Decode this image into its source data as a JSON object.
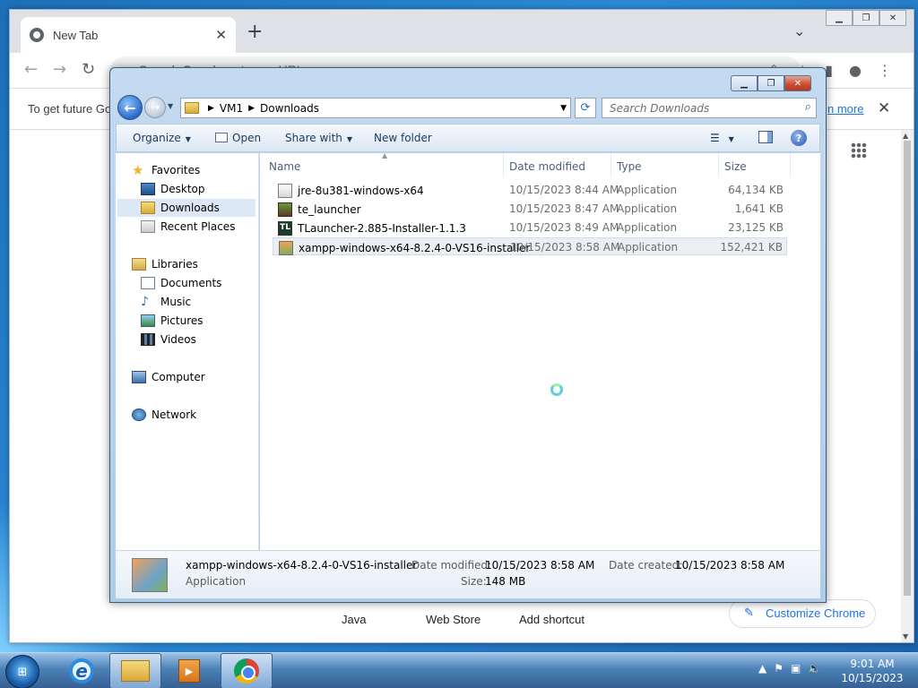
{
  "chrome": {
    "tab_title": "New Tab",
    "tab_close": "✕",
    "new_tab": "+",
    "tab_dropdown": "⌄",
    "omnibox_placeholder": "Search Google or type a URL",
    "infobar_message": "To get future Go",
    "infobar_link": "n more",
    "infobar_close": "✕",
    "shortcuts": [
      "Java",
      "Web Store",
      "Add shortcut"
    ],
    "customize_label": "Customize Chrome"
  },
  "explorer": {
    "breadcrumb": [
      "VM1",
      "Downloads"
    ],
    "search_placeholder": "Search Downloads",
    "commands": {
      "organize": "Organize",
      "open": "Open",
      "share_with": "Share with",
      "new_folder": "New folder"
    },
    "nav": {
      "favorites_header": "Favorites",
      "favorites": [
        "Desktop",
        "Downloads",
        "Recent Places"
      ],
      "libraries_header": "Libraries",
      "libraries": [
        "Documents",
        "Music",
        "Pictures",
        "Videos"
      ],
      "computer": "Computer",
      "network": "Network",
      "selected": "Downloads"
    },
    "columns": [
      "Name",
      "Date modified",
      "Type",
      "Size"
    ],
    "files": [
      {
        "name": "jre-8u381-windows-x64",
        "date": "10/15/2023 8:44 AM",
        "type": "Application",
        "size": "64,134 KB",
        "icon": "java-icon"
      },
      {
        "name": "te_launcher",
        "date": "10/15/2023 8:47 AM",
        "type": "Application",
        "size": "1,641 KB",
        "icon": "minecraft-icon"
      },
      {
        "name": "TLauncher-2.885-Installer-1.1.3",
        "date": "10/15/2023 8:49 AM",
        "type": "Application",
        "size": "23,125 KB",
        "icon": "tlauncher-icon"
      },
      {
        "name": "xampp-windows-x64-8.2.4-0-VS16-installer",
        "date": "10/15/2023 8:58 AM",
        "type": "Application",
        "size": "152,421 KB",
        "icon": "xampp-icon"
      }
    ],
    "selected_file_index": 3,
    "details": {
      "name": "xampp-windows-x64-8.2.4-0-VS16-installer",
      "type": "Application",
      "date_modified_label": "Date modified:",
      "date_modified": "10/15/2023 8:58 AM",
      "date_created_label": "Date created:",
      "date_created": "10/15/2023 8:58 AM",
      "size_label": "Size:",
      "size": "148 MB"
    }
  },
  "taskbar": {
    "time": "9:01 AM",
    "date": "10/15/2023"
  },
  "colors": {
    "accent": "#1a73e8",
    "desktop": "#1c6fb8",
    "close_red": "#c84a2f"
  }
}
